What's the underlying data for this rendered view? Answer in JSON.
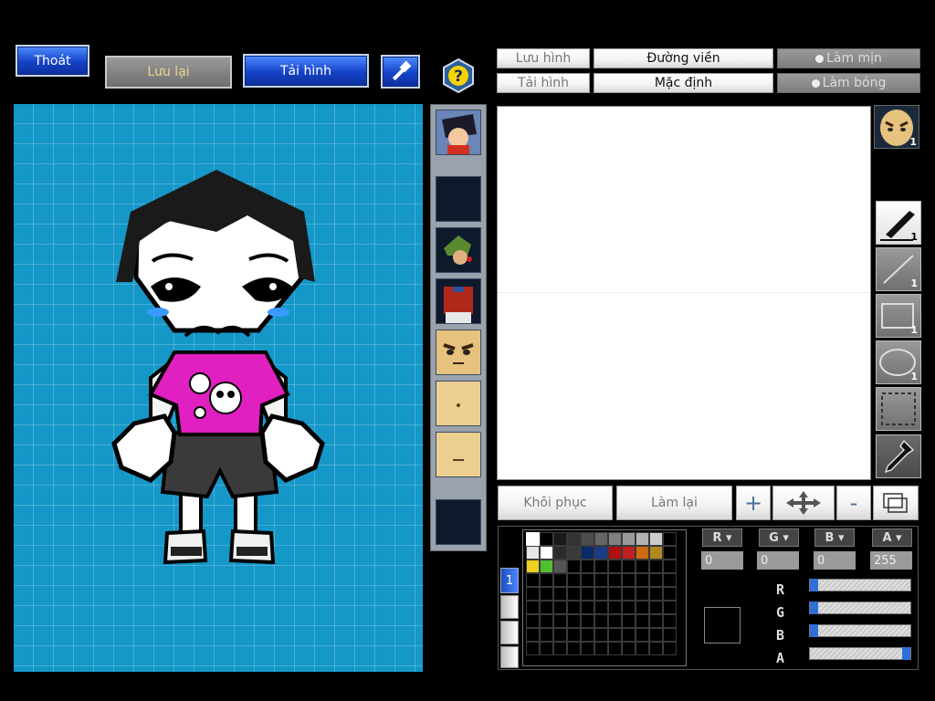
{
  "top_left": {
    "exit_label": "Thoát",
    "save_label": "Lưu lại",
    "load_label": "Tải hình"
  },
  "top_right": {
    "save_image_label": "Lưu hình",
    "load_image_label": "Tải hình",
    "outline_label": "Đường viền",
    "default_label": "Mặc định",
    "smooth_label": "Làm mịn",
    "shadow_label": "Làm bóng"
  },
  "bottom_buttons": {
    "restore_label": "Khôi phục",
    "redo_label": "Làm lại",
    "plus_label": "+",
    "minus_label": "-"
  },
  "tools": {
    "pen_count": "1",
    "line_count": "1",
    "rect_count": "1",
    "ellipse_count": "1",
    "face_count": "1"
  },
  "palette": {
    "layer_tab": "1",
    "channel_r": "R",
    "channel_g": "G",
    "channel_b": "B",
    "channel_a": "A",
    "r_value": "0",
    "g_value": "0",
    "b_value": "0",
    "a_value": "255",
    "colors_row1": [
      "#ffffff",
      "#000000",
      "#1a1a1a",
      "#333333",
      "#4d4d4d",
      "#666666",
      "#808080",
      "#999999",
      "#b3b3b3",
      "#cccccc"
    ],
    "colors_row2": [
      "#e6e6e6",
      "#ffffff",
      "#2b2b2b",
      "#3a3a3a",
      "#0a2a6a",
      "#1a3a8a",
      "#b01010",
      "#c02020",
      "#d06a10",
      "#b08a20"
    ],
    "colors_row3": [
      "#f0d020",
      "#50c030",
      "#555555"
    ],
    "slider_r": 0,
    "slider_g": 0,
    "slider_b": 0,
    "slider_a": 1
  },
  "colors": {
    "grid_background": "#1597c8",
    "shirt": "#e020c0",
    "accent_blue": "#1442c8"
  }
}
